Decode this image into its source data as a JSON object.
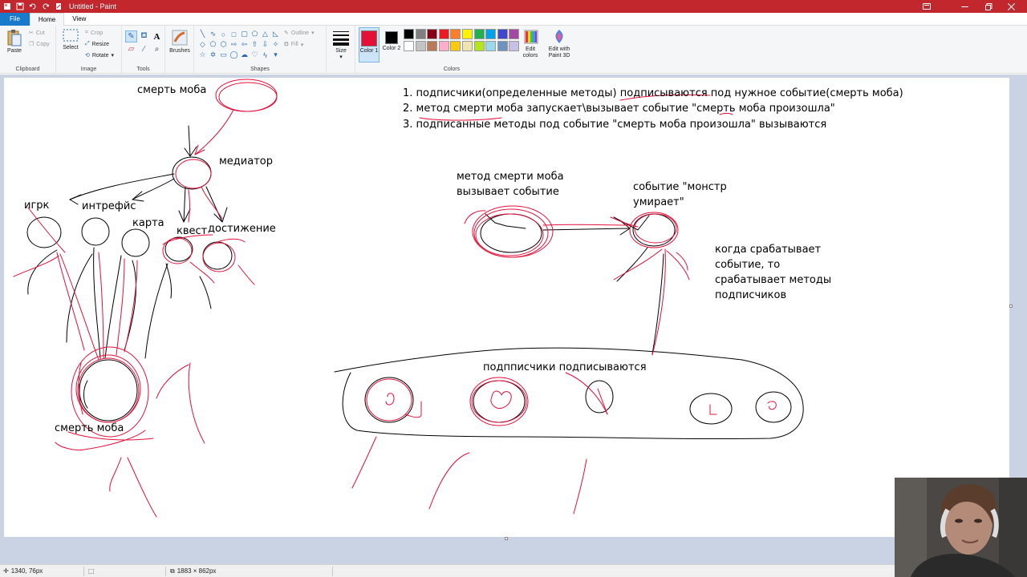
{
  "window": {
    "title": "Untitled - Paint"
  },
  "tabs": [
    "File",
    "Home",
    "View"
  ],
  "ribbon": {
    "clipboard": {
      "label": "Clipboard",
      "paste": "Paste",
      "cut": "Cut",
      "copy": "Copy"
    },
    "image": {
      "label": "Image",
      "select": "Select",
      "crop": "Crop",
      "resize": "Resize",
      "rotate": "Rotate"
    },
    "tools": {
      "label": "Tools"
    },
    "brushes": {
      "label": "Brushes"
    },
    "shapes": {
      "label": "Shapes",
      "outline": "Outline",
      "fill": "Fill"
    },
    "size": {
      "label": "Size"
    },
    "colors": {
      "label": "Colors",
      "color1": "Color 1",
      "color2": "Color 2",
      "edit_colors": "Edit colors",
      "edit_paint3d": "Edit with Paint 3D",
      "color1_value": "#e4103a",
      "color2_value": "#000000",
      "palette": [
        "#000000",
        "#7f7f7f",
        "#880015",
        "#ed1c24",
        "#ff7f27",
        "#fff200",
        "#22b14c",
        "#00a2e8",
        "#3f48cc",
        "#a349a4",
        "#ffffff",
        "#c3c3c3",
        "#b97a57",
        "#ffaec9",
        "#ffc90e",
        "#efe4b0",
        "#b5e61d",
        "#99d9ea",
        "#7092be",
        "#c8bfe7"
      ]
    }
  },
  "canvas_text": {
    "mob_death_top": "смерть моба",
    "mediator": "медиатор",
    "player": "игрк",
    "interface": "интрефйс",
    "map": "карта",
    "quest": "квест",
    "achievement": "достижение",
    "mob_death_bottom": "смерть моба",
    "list_1": "1. подписчики(определенные методы) подписываются под нужное событие(смерть моба)",
    "list_2": "2. метод смерти моба запускает\\вызывает событие \"смерть моба произошла\"",
    "list_3": "3. подписанные методы под событие \"смерть моба произошла\" вызываются",
    "method_calls": "метод смерти моба вызывает событие",
    "event_monster": "событие \"монстр умирает\"",
    "when_triggered": "когда срабатывает событие, то срабатывает методы подписчиков",
    "subscribers": "подпписчики подписываются"
  },
  "statusbar": {
    "cursor_pos": "1340, 76px",
    "canvas_size": "1883 × 862px"
  },
  "colors": {
    "titlebar": "#c1272d",
    "ink_red": "#e4103a",
    "ink_black": "#000000",
    "workspace": "#c9d3e3"
  }
}
